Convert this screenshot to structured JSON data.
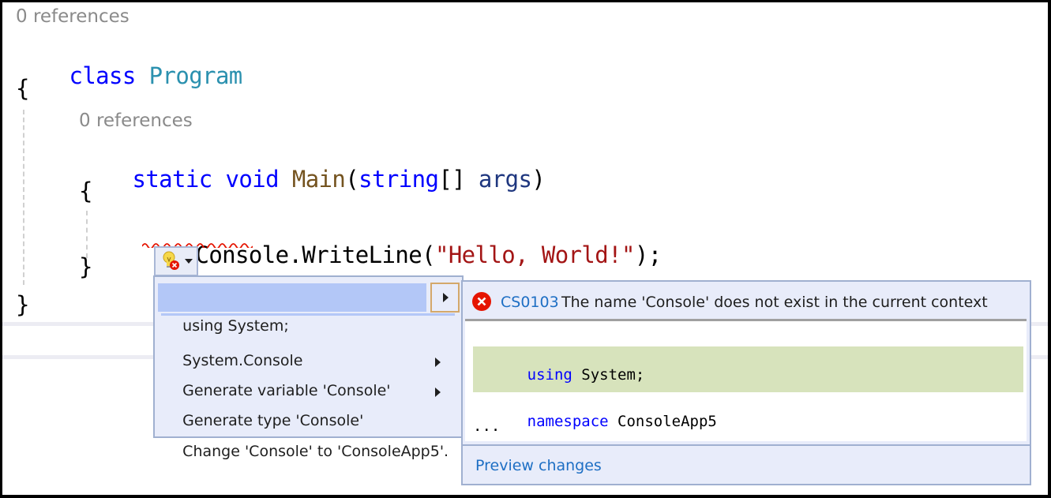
{
  "editor": {
    "lines": [
      {
        "codelens": "0 references"
      },
      {
        "tokens": [
          {
            "t": "class",
            "k": "kw"
          },
          {
            "t": " ",
            "k": "plain"
          },
          {
            "t": "Program",
            "k": "type"
          }
        ]
      },
      {
        "tokens": [
          {
            "t": "{",
            "k": "plain"
          }
        ]
      },
      {
        "codelens": "0 references"
      },
      {
        "tokens": [
          {
            "t": "static",
            "k": "kw"
          },
          {
            "t": " ",
            "k": "plain"
          },
          {
            "t": "void",
            "k": "kw"
          },
          {
            "t": " ",
            "k": "plain"
          },
          {
            "t": "Main",
            "k": "method"
          },
          {
            "t": "(",
            "k": "plain"
          },
          {
            "t": "string",
            "k": "kw"
          },
          {
            "t": "[] ",
            "k": "plain"
          },
          {
            "t": "args",
            "k": "param"
          },
          {
            "t": ")",
            "k": "plain"
          }
        ]
      },
      {
        "tokens": [
          {
            "t": "{",
            "k": "plain"
          }
        ]
      },
      {
        "tokens": [
          {
            "t": "Console",
            "k": "plain"
          },
          {
            "t": ".WriteLine(",
            "k": "plain"
          },
          {
            "t": "\"Hello, World!\"",
            "k": "str"
          },
          {
            "t": ");",
            "k": "plain"
          }
        ]
      },
      {
        "tokens": [
          {
            "t": "}",
            "k": "plain"
          }
        ]
      },
      {
        "tokens": [
          {
            "t": "}",
            "k": "plain"
          }
        ]
      }
    ],
    "error_token": "Console",
    "colors": {
      "keyword": "#0000ff",
      "type": "#2b91af",
      "method": "#74531f",
      "param": "#1f377f",
      "string": "#a31515",
      "squiggle": "#e51400"
    }
  },
  "lightbulb": {
    "icon": "lightbulb-error-icon",
    "dropdown_icon": "caret-down-icon"
  },
  "quick_actions_menu": {
    "items": [
      {
        "label": "using System;",
        "selected": true,
        "has_submenu": true
      },
      {
        "label": "System.Console",
        "selected": false,
        "has_submenu": false
      },
      {
        "label": "Generate variable 'Console'",
        "selected": false,
        "has_submenu": true
      },
      {
        "label": "Generate type 'Console'",
        "selected": false,
        "has_submenu": true
      },
      {
        "label": "Change 'Console' to 'ConsoleApp5'.",
        "selected": false,
        "has_submenu": false
      }
    ]
  },
  "preview_panel": {
    "error_code": "CS0103",
    "error_message": "The name 'Console' does not exist in the current context",
    "error_icon": "error-circle-icon",
    "preview_lines": [
      {
        "tokens": [
          {
            "t": "using",
            "k": "kw"
          },
          {
            "t": " System;",
            "k": "plain"
          }
        ],
        "added": true
      },
      {
        "tokens": [
          {
            "t": "namespace",
            "k": "kw"
          },
          {
            "t": " ConsoleApp5",
            "k": "plain"
          }
        ],
        "added": false
      },
      {
        "tokens": [
          {
            "t": "...",
            "k": "plain"
          }
        ],
        "added": false
      }
    ],
    "preview_link": "Preview changes",
    "link_color": "#1e6fc4"
  }
}
